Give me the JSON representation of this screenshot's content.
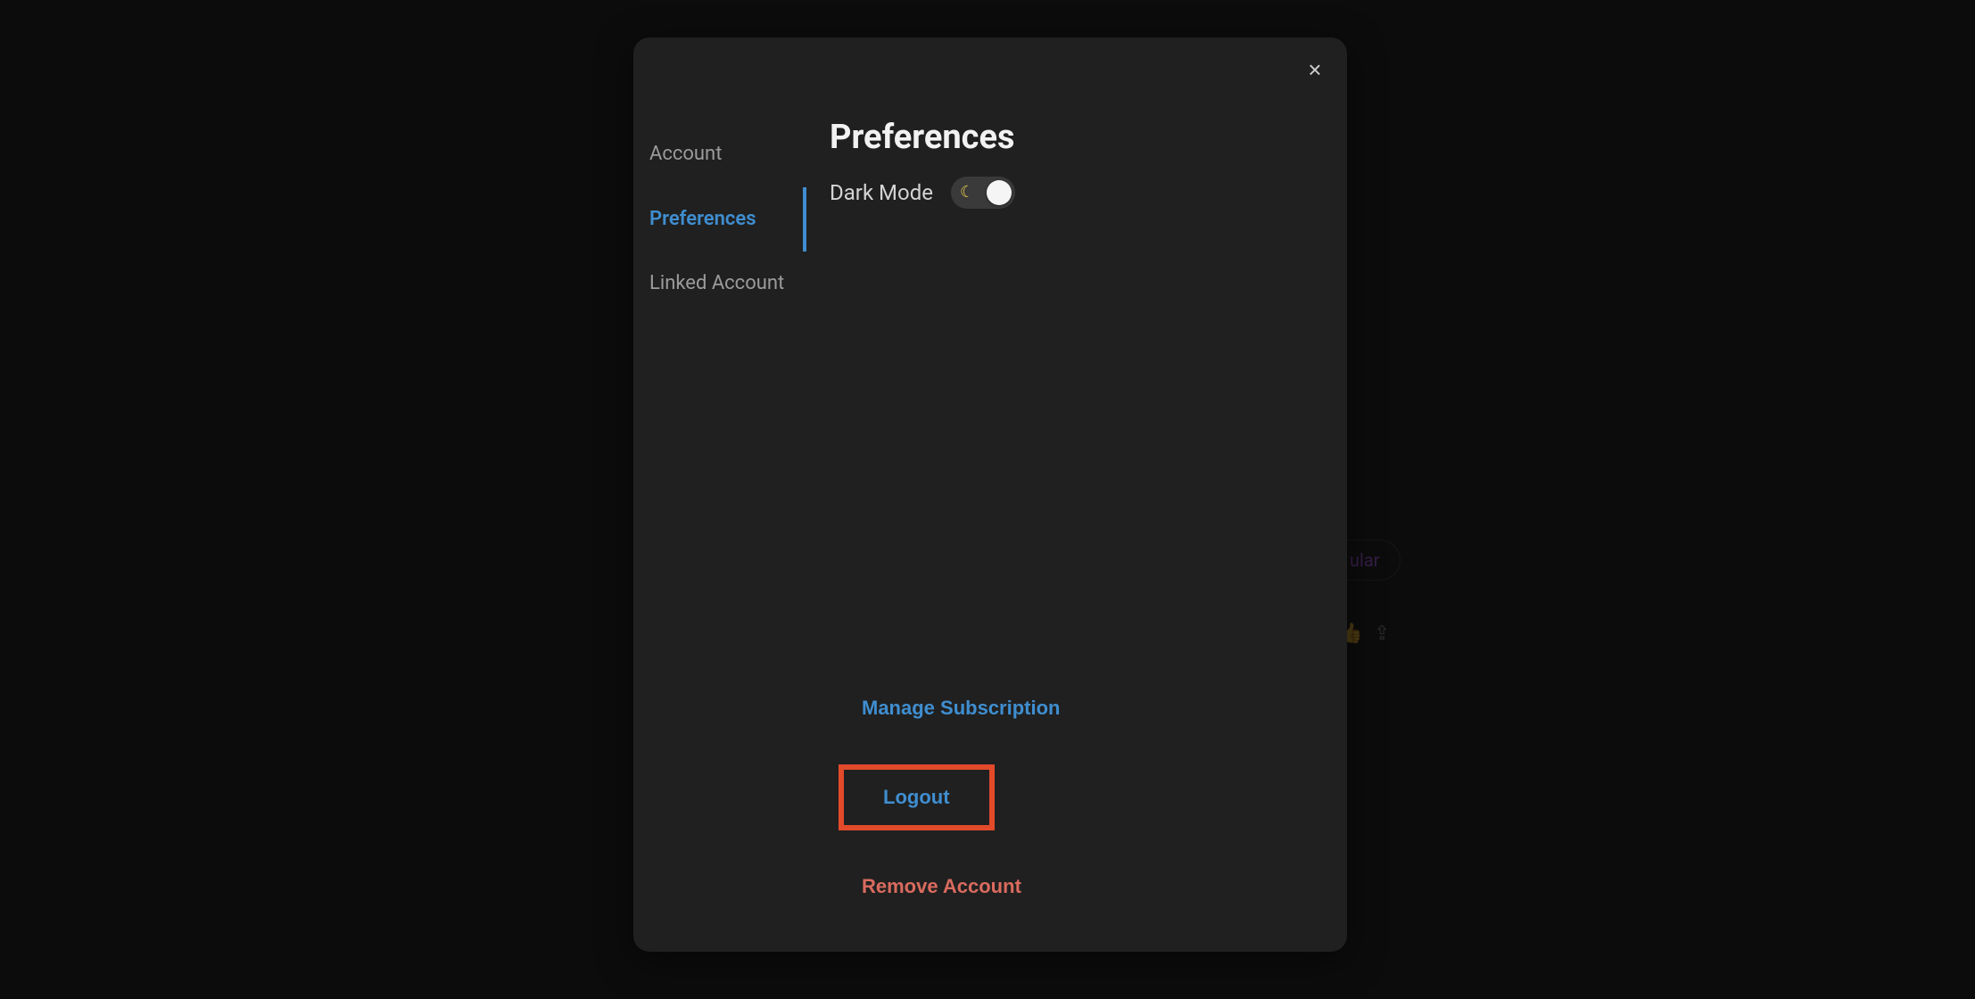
{
  "background": {
    "badge_label": "ular",
    "thumbs_icon": "👍",
    "share_icon": "⇪"
  },
  "modal": {
    "close_label": "×",
    "sidebar": {
      "items": [
        {
          "label": "Account"
        },
        {
          "label": "Preferences"
        },
        {
          "label": "Linked Account"
        }
      ],
      "active_index": 1
    },
    "main": {
      "heading": "Preferences",
      "dark_mode_label": "Dark Mode",
      "dark_mode_on": true,
      "moon_icon": "☾"
    },
    "footer": {
      "manage_subscription": "Manage Subscription",
      "logout": "Logout",
      "remove_account": "Remove Account"
    }
  }
}
